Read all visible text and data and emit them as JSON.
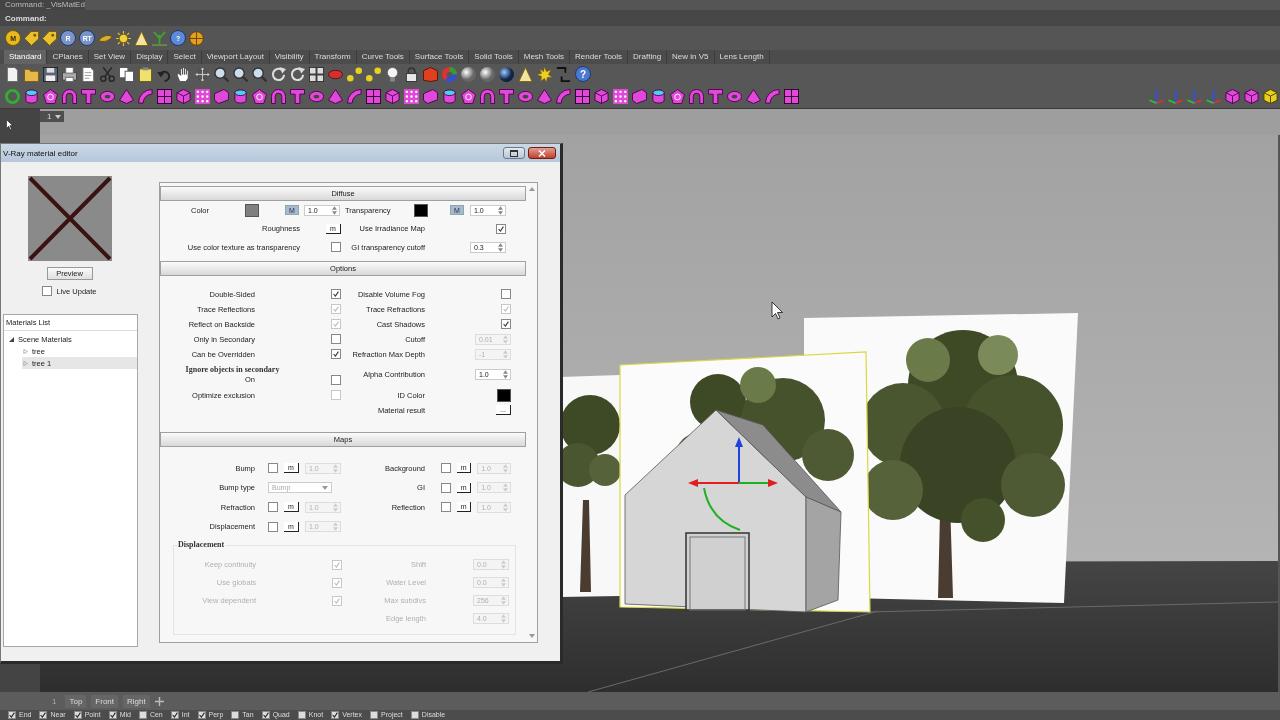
{
  "command_line": {
    "history": "Command: _VisMatEd",
    "prompt": "Command:"
  },
  "vray_toolbar": {
    "letters": [
      "M",
      "R",
      "RT",
      "?"
    ]
  },
  "toolbar_tabs": [
    {
      "label": "Standard",
      "selected": true
    },
    {
      "label": "CPlanes",
      "selected": false
    },
    {
      "label": "Set View",
      "selected": false
    },
    {
      "label": "Display",
      "selected": false
    },
    {
      "label": "Select",
      "selected": false
    },
    {
      "label": "Viewport Layout",
      "selected": false
    },
    {
      "label": "Visibility",
      "selected": false
    },
    {
      "label": "Transform",
      "selected": false
    },
    {
      "label": "Curve Tools",
      "selected": false
    },
    {
      "label": "Surface Tools",
      "selected": false
    },
    {
      "label": "Solid Tools",
      "selected": false
    },
    {
      "label": "Mesh Tools",
      "selected": false
    },
    {
      "label": "Render Tools",
      "selected": false
    },
    {
      "label": "Drafting",
      "selected": false
    },
    {
      "label": "New in V5",
      "selected": false
    },
    {
      "label": "Lens Length",
      "selected": false
    }
  ],
  "standard_toolbar": {
    "help_label": "?"
  },
  "viewport": {
    "title": "1",
    "tabs": [
      {
        "label": "1",
        "selected": true
      },
      {
        "label": "Top",
        "selected": false
      },
      {
        "label": "Front",
        "selected": false
      },
      {
        "label": "Right",
        "selected": false
      }
    ]
  },
  "dialog": {
    "title": "V-Ray material editor",
    "preview_button": "Preview",
    "live_update": {
      "label": "Live Update",
      "checked": false
    },
    "materials_list": {
      "title": "Materials List",
      "items": [
        {
          "label": "Scene Materials",
          "expanded": true,
          "selected": false,
          "children": [
            {
              "label": "tree",
              "expanded": false,
              "selected": false
            },
            {
              "label": "tree 1",
              "expanded": false,
              "selected": true
            }
          ]
        }
      ]
    },
    "diffuse": {
      "title": "Diffuse",
      "rows": [
        {
          "left": {
            "kind": "color_map",
            "label": "Color",
            "color": "#7f7f7f",
            "map_button": "M",
            "value": "1.0"
          },
          "right": {
            "kind": "color_map",
            "label": "Transparency",
            "color": "#000000",
            "map_button": "M",
            "value": "1.0"
          }
        },
        {
          "left": {
            "kind": "button",
            "label": "Roughness",
            "button": "m"
          },
          "right": {
            "kind": "checkbox",
            "label": "Use Irradiance Map",
            "checked": true,
            "disabled": false
          }
        },
        {
          "left": {
            "kind": "checkbox",
            "label": "Use color texture as transparency",
            "checked": false,
            "disabled": false
          },
          "right": {
            "kind": "spinner",
            "label": "GI transparency cutoff",
            "value": "0.3",
            "disabled": false
          }
        }
      ]
    },
    "options": {
      "title": "Options",
      "rows": [
        {
          "left": {
            "kind": "checkbox",
            "label": "Double-Sided",
            "checked": true,
            "disabled": false
          },
          "right": {
            "kind": "checkbox",
            "label": "Disable Volume Fog",
            "checked": false,
            "disabled": false
          }
        },
        {
          "left": {
            "kind": "checkbox",
            "label": "Trace Reflections",
            "checked": true,
            "disabled": true
          },
          "right": {
            "kind": "checkbox",
            "label": "Trace Refractions",
            "checked": true,
            "disabled": true
          }
        },
        {
          "left": {
            "kind": "checkbox",
            "label": "Reflect on Backside",
            "checked": true,
            "disabled": true
          },
          "right": {
            "kind": "checkbox",
            "label": "Cast Shadows",
            "checked": true,
            "disabled": false
          }
        },
        {
          "left": {
            "kind": "checkbox",
            "label": "Only in Secondary",
            "checked": false,
            "disabled": false
          },
          "right": {
            "kind": "spinner",
            "label": "Cutoff",
            "value": "0.01",
            "disabled": true
          }
        },
        {
          "left": {
            "kind": "checkbox",
            "label": "Can be Overridden",
            "checked": true,
            "disabled": false
          },
          "right": {
            "kind": "spinner",
            "label": "Refraction Max Depth",
            "value": "-1",
            "disabled": true
          }
        },
        {
          "left": {
            "kind": "group",
            "title": "Ignore objects in secondary",
            "label": "On",
            "checked": false,
            "disabled": false
          },
          "right": {
            "kind": "spinner",
            "label": "Alpha Contribution",
            "value": "1.0",
            "disabled": false
          }
        },
        {
          "left": {
            "kind": "checkbox",
            "label": "Optimize exclusion",
            "checked": false,
            "disabled": true
          },
          "right": {
            "kind": "swatch",
            "label": "ID Color",
            "color": "#000000"
          }
        },
        {
          "right": {
            "kind": "button",
            "label": "Material result",
            "button": "..."
          }
        }
      ]
    },
    "maps": {
      "title": "Maps",
      "rows": [
        {
          "left": {
            "kind": "map",
            "label": "Bump",
            "checked": false,
            "map_button": "m",
            "value": "1.0",
            "disabled": true
          },
          "right": {
            "kind": "map",
            "label": "Background",
            "checked": false,
            "map_button": "m",
            "value": "1.0",
            "disabled": true
          }
        },
        {
          "left": {
            "kind": "dropdown",
            "label": "Bump type",
            "value": "Bump",
            "disabled": true
          },
          "right": {
            "kind": "map",
            "label": "GI",
            "checked": false,
            "map_button": "m",
            "value": "1.0",
            "disabled": true
          }
        },
        {
          "left": {
            "kind": "map",
            "label": "Refraction",
            "checked": false,
            "map_button": "m",
            "value": "1.0",
            "disabled": true
          },
          "right": {
            "kind": "map",
            "label": "Reflection",
            "checked": false,
            "map_button": "m",
            "value": "1.0",
            "disabled": true
          }
        },
        {
          "left": {
            "kind": "map",
            "label": "Displacement",
            "checked": false,
            "map_button": "m",
            "value": "1.0",
            "disabled": true
          }
        }
      ],
      "displacement": {
        "title": "Displacement",
        "disabled": true,
        "rows": [
          {
            "left": {
              "kind": "checkbox",
              "label": "Keep continuity",
              "checked": true,
              "disabled": true
            },
            "right": {
              "kind": "spinner",
              "label": "Shift",
              "value": "0.0",
              "disabled": true
            }
          },
          {
            "left": {
              "kind": "checkbox",
              "label": "Use globals",
              "checked": true,
              "disabled": true
            },
            "right": {
              "kind": "spinner",
              "label": "Water Level",
              "value": "0.0",
              "disabled": true
            }
          },
          {
            "left": {
              "kind": "checkbox",
              "label": "View dependent",
              "checked": true,
              "disabled": true
            },
            "right": {
              "kind": "spinner",
              "label": "Max subdivs",
              "value": "256",
              "disabled": true
            }
          },
          {
            "right": {
              "kind": "spinner",
              "label": "Edge length",
              "value": "4.0",
              "disabled": true
            }
          }
        ]
      }
    }
  },
  "osnaps": [
    {
      "label": "End",
      "checked": true
    },
    {
      "label": "Near",
      "checked": true
    },
    {
      "label": "Point",
      "checked": true
    },
    {
      "label": "Mid",
      "checked": true
    },
    {
      "label": "Cen",
      "checked": false
    },
    {
      "label": "Int",
      "checked": true
    },
    {
      "label": "Perp",
      "checked": true
    },
    {
      "label": "Tan",
      "checked": false
    },
    {
      "label": "Quad",
      "checked": true
    },
    {
      "label": "Knot",
      "checked": false
    },
    {
      "label": "Vertex",
      "checked": true
    },
    {
      "label": "Project",
      "checked": false
    },
    {
      "label": "Disable",
      "checked": false
    }
  ]
}
